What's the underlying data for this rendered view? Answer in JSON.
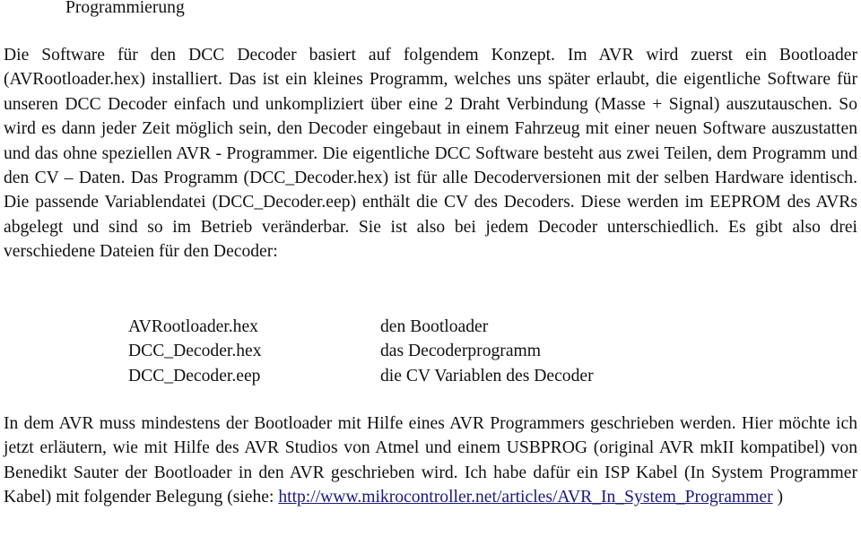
{
  "document": {
    "heading": "Programmierung",
    "paragraph1": "Die Software für den DCC Decoder basiert auf folgendem Konzept. Im AVR wird zuerst ein Bootloader (AVRootloader.hex) installiert. Das ist ein kleines Programm, welches uns später erlaubt, die eigentliche Software für unseren DCC Decoder einfach und unkompliziert über eine 2 Draht Verbindung (Masse + Signal) auszutauschen. So wird es dann jeder Zeit möglich sein, den Decoder eingebaut in einem Fahrzeug mit einer neuen Software auszustatten und das ohne speziellen AVR - Programmer. Die eigentliche DCC Software besteht aus zwei Teilen, dem Programm und den CV – Daten. Das Programm (DCC_Decoder.hex) ist für alle Decoderversionen mit der selben Hardware identisch. Die passende Variablendatei (DCC_Decoder.eep) enthält die CV des Decoders. Diese werden im EEPROM des AVRs abgelegt und sind so im Betrieb veränderbar. Sie ist also bei jedem Decoder unterschiedlich. Es gibt also drei verschiedene Dateien für den Decoder:",
    "files": [
      {
        "name": "AVRootloader.hex",
        "description": "den Bootloader"
      },
      {
        "name": "DCC_Decoder.hex",
        "description": "das Decoderprogramm"
      },
      {
        "name": "DCC_Decoder.eep",
        "description": "die CV Variablen des Decoder"
      }
    ],
    "paragraph2_before_link": "In dem AVR muss mindestens der Bootloader mit Hilfe eines AVR Programmers geschrieben werden. Hier möchte ich jetzt erläutern, wie mit Hilfe des AVR Studios von Atmel und einem USBPROG (original AVR mkII kompatibel) von Benedikt Sauter der Bootloader in den AVR geschrieben wird. Ich habe dafür ein ISP Kabel (In System Programmer Kabel) mit folgender Belegung (siehe: ",
    "link_text": "http://www.mikrocontroller.net/articles/AVR_In_System_Programmer",
    "paragraph2_after_link": " )",
    "link_color": "#1a1a7a"
  }
}
